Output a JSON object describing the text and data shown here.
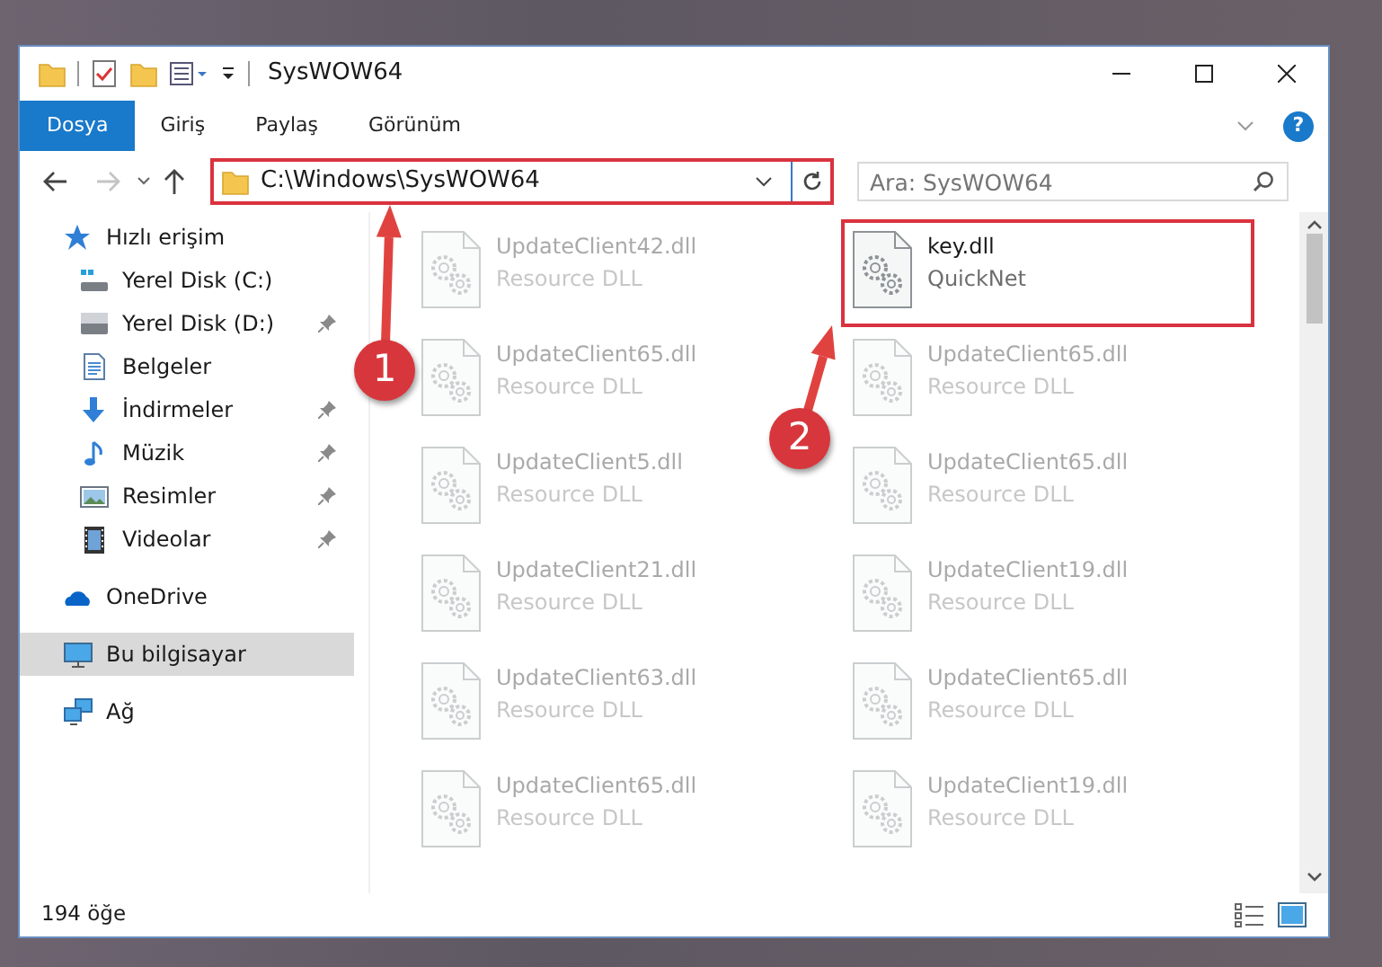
{
  "window": {
    "title": "SysWOW64"
  },
  "ribbon_tabs": [
    {
      "label": "Dosya",
      "selected": true
    },
    {
      "label": "Giriş",
      "selected": false
    },
    {
      "label": "Paylaş",
      "selected": false
    },
    {
      "label": "Görünüm",
      "selected": false
    }
  ],
  "help": "?",
  "navigation": {
    "forward_disabled": true
  },
  "address": {
    "path": "C:\\Windows\\SysWOW64"
  },
  "search": {
    "placeholder": "Ara: SysWOW64"
  },
  "sidebar": {
    "items": [
      {
        "label": "Hızlı erişim",
        "kind": "star",
        "pinned": false,
        "selected": false,
        "children": [
          {
            "label": "Yerel Disk (C:)",
            "kind": "drive-c",
            "pinned": false,
            "selected": false
          },
          {
            "label": "Yerel Disk (D:)",
            "kind": "drive",
            "pinned": true,
            "selected": false
          },
          {
            "label": "Belgeler",
            "kind": "documents",
            "pinned": false,
            "selected": false
          },
          {
            "label": "İndirmeler",
            "kind": "downloads",
            "pinned": true,
            "selected": false
          },
          {
            "label": "Müzik",
            "kind": "music",
            "pinned": true,
            "selected": false
          },
          {
            "label": "Resimler",
            "kind": "pictures",
            "pinned": true,
            "selected": false
          },
          {
            "label": "Videolar",
            "kind": "videos",
            "pinned": true,
            "selected": false
          }
        ]
      },
      {
        "label": "OneDrive",
        "kind": "cloud",
        "pinned": false,
        "selected": false
      },
      {
        "label": "Bu bilgisayar",
        "kind": "computer",
        "pinned": false,
        "selected": true
      },
      {
        "label": "Ağ",
        "kind": "network",
        "pinned": false,
        "selected": false
      }
    ]
  },
  "files": [
    {
      "name": "UpdateClient42.dll",
      "type": "Resource DLL",
      "highlighted": false
    },
    {
      "name": "key.dll",
      "type": "QuickNet",
      "highlighted": true
    },
    {
      "name": "UpdateClient65.dll",
      "type": "Resource DLL",
      "highlighted": false
    },
    {
      "name": "UpdateClient65.dll",
      "type": "Resource DLL",
      "highlighted": false
    },
    {
      "name": "UpdateClient5.dll",
      "type": "Resource DLL",
      "highlighted": false
    },
    {
      "name": "UpdateClient65.dll",
      "type": "Resource DLL",
      "highlighted": false
    },
    {
      "name": "UpdateClient21.dll",
      "type": "Resource DLL",
      "highlighted": false
    },
    {
      "name": "UpdateClient19.dll",
      "type": "Resource DLL",
      "highlighted": false
    },
    {
      "name": "UpdateClient63.dll",
      "type": "Resource DLL",
      "highlighted": false
    },
    {
      "name": "UpdateClient65.dll",
      "type": "Resource DLL",
      "highlighted": false
    },
    {
      "name": "UpdateClient65.dll",
      "type": "Resource DLL",
      "highlighted": false
    },
    {
      "name": "UpdateClient19.dll",
      "type": "Resource DLL",
      "highlighted": false
    }
  ],
  "status_bar": {
    "count": "194 öğe"
  },
  "annotations": [
    {
      "number": "1"
    },
    {
      "number": "2"
    }
  ]
}
